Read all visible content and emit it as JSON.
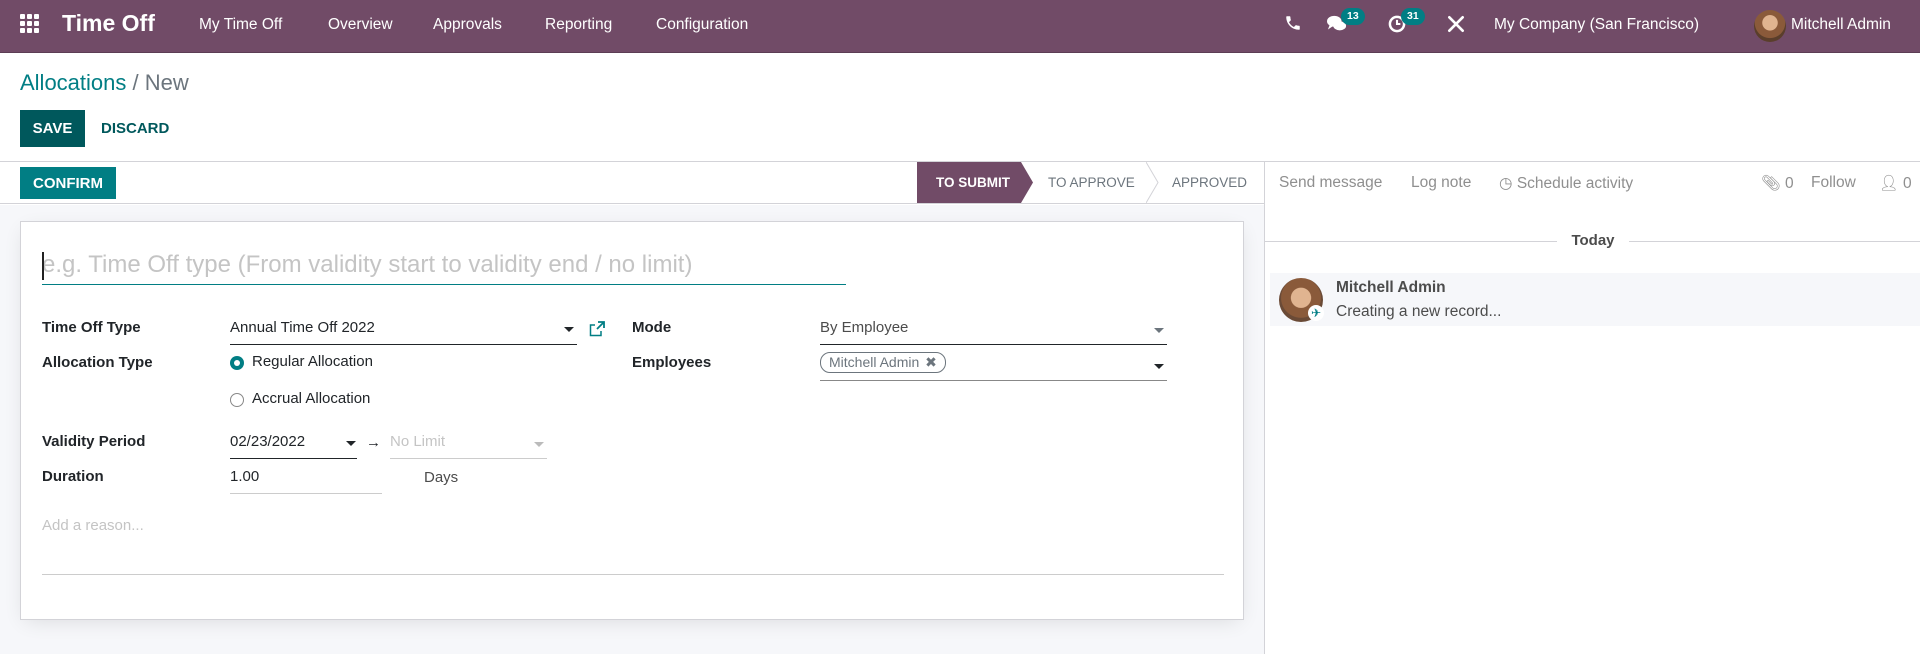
{
  "navbar": {
    "app_title": "Time Off",
    "menu": [
      "My Time Off",
      "Overview",
      "Approvals",
      "Reporting",
      "Configuration"
    ],
    "messages_badge": "13",
    "activities_badge": "31",
    "company": "My Company (San Francisco)",
    "user": "Mitchell Admin",
    "colors": {
      "navbar_bg": "#714b67",
      "badge_bg": "#017e84"
    }
  },
  "breadcrumb": {
    "parent": "Allocations",
    "separator": "/",
    "current": "New"
  },
  "actions": {
    "save": "SAVE",
    "discard": "DISCARD",
    "confirm": "CONFIRM"
  },
  "statusbar": {
    "stages": [
      {
        "label": "TO SUBMIT",
        "active": true
      },
      {
        "label": "TO APPROVE",
        "active": false
      },
      {
        "label": "APPROVED",
        "active": false
      }
    ]
  },
  "form": {
    "name_placeholder": "e.g. Time Off type (From validity start to validity end / no limit)",
    "time_off_type": {
      "label": "Time Off Type",
      "value": "Annual Time Off 2022"
    },
    "allocation_type": {
      "label": "Allocation Type",
      "options": [
        {
          "label": "Regular Allocation",
          "selected": true
        },
        {
          "label": "Accrual Allocation",
          "selected": false
        }
      ]
    },
    "validity_period": {
      "label": "Validity Period",
      "start": "02/23/2022",
      "end_placeholder": "No Limit"
    },
    "duration": {
      "label": "Duration",
      "value": "1.00",
      "unit": "Days"
    },
    "mode": {
      "label": "Mode",
      "value": "By Employee"
    },
    "employees": {
      "label": "Employees",
      "tags": [
        "Mitchell Admin"
      ]
    },
    "reason_placeholder": "Add a reason..."
  },
  "chatter": {
    "send_message": "Send message",
    "log_note": "Log note",
    "schedule_activity": "Schedule activity",
    "attachments_count": "0",
    "follow": "Follow",
    "followers_count": "0",
    "date_separator": "Today",
    "messages": [
      {
        "author": "Mitchell Admin",
        "body": "Creating a new record..."
      }
    ]
  }
}
